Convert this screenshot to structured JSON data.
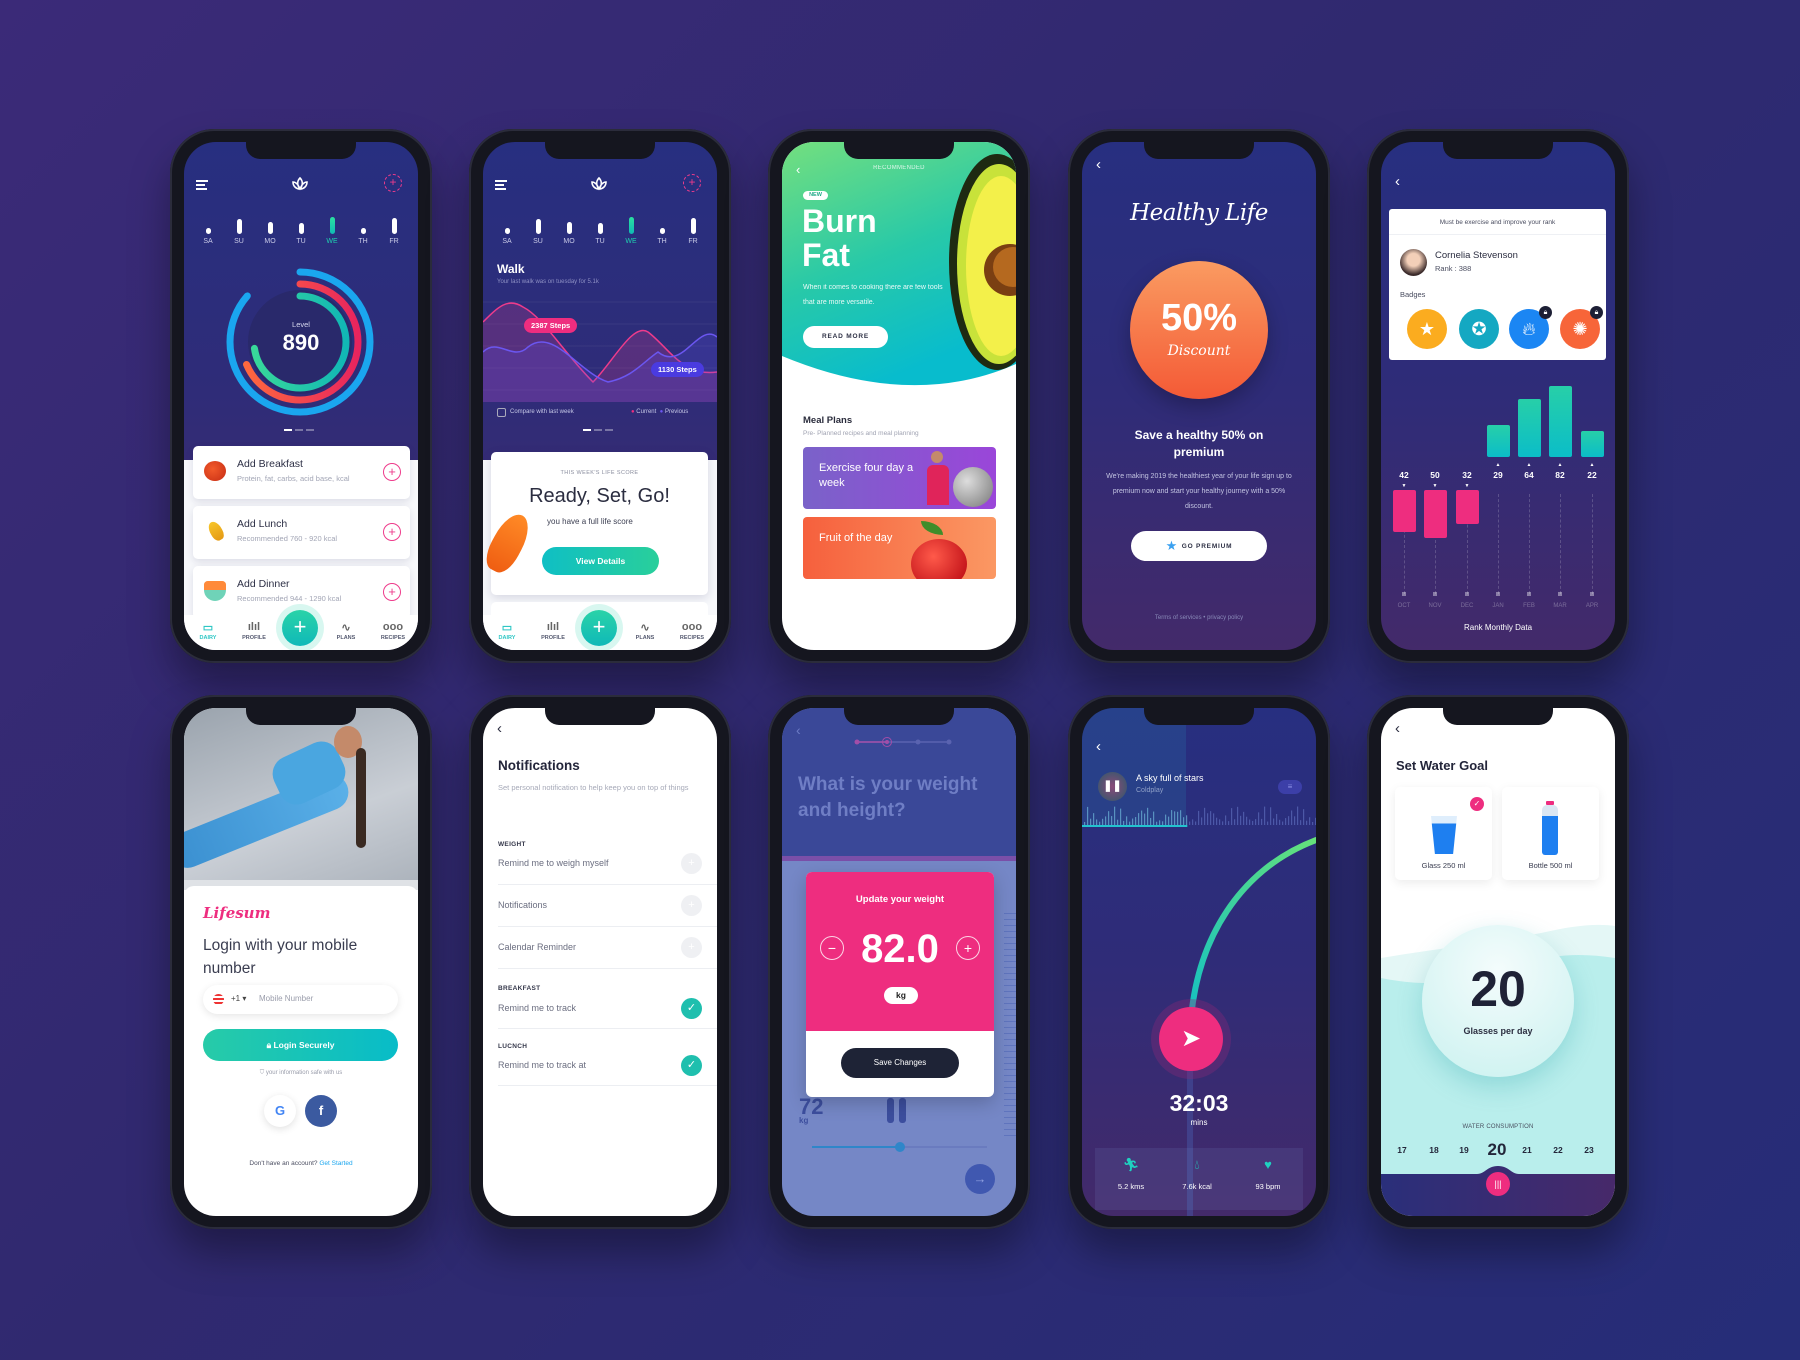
{
  "colors": {
    "accent_pink": "#ee2d7f",
    "accent_teal": "#14c3b4",
    "accent_green": "#2bd98f",
    "background": "#30296f",
    "phone_frame": "#15161f"
  },
  "screens": {
    "diary": {
      "days": [
        {
          "label": "SA",
          "level": 0.1
        },
        {
          "label": "SU",
          "level": 0.8
        },
        {
          "label": "MO",
          "level": 0.6
        },
        {
          "label": "TU",
          "level": 0.5
        },
        {
          "label": "WE",
          "level": 1.0,
          "active": true
        },
        {
          "label": "TH",
          "level": 0.1
        },
        {
          "label": "FR",
          "level": 0.9
        }
      ],
      "level_label": "Level",
      "level_value": "890",
      "meals": [
        {
          "title": "Add Breakfast",
          "subtitle": "Protein, fat, carbs, acid base, kcal",
          "icon": "fruit-icon"
        },
        {
          "title": "Add Lunch",
          "subtitle": "Recommended 760 - 920 kcal",
          "icon": "corn-icon"
        },
        {
          "title": "Add Dinner",
          "subtitle": "Recommended 944 - 1290 kcal",
          "icon": "salad-bowl-icon"
        }
      ],
      "nav": [
        {
          "label": "DAIRY",
          "icon": "calendar-icon",
          "active": true
        },
        {
          "label": "PROFILE",
          "icon": "bar-chart-icon"
        },
        {
          "label": "PLANS",
          "icon": "pulse-icon"
        },
        {
          "label": "RECIPES",
          "icon": "dots-icon"
        }
      ]
    },
    "walk": {
      "title": "Walk",
      "subtitle": "Your last walk was on tuesday for 5.1k",
      "current_badge": "2387 Steps",
      "previous_badge": "1130 Steps",
      "compare_label": "Compare with last week",
      "legend_current": "Current",
      "legend_previous": "Previous",
      "card_kicker": "THIS WEEK'S LIFE SCORE",
      "card_title": "Ready, Set, Go!",
      "card_text": "you have a full life score",
      "button": "View Details"
    },
    "recommended": {
      "header": "RECOMMENDED",
      "badge": "NEW",
      "title_line1": "Burn",
      "title_line2": "Fat",
      "description": "When it comes to cooking there are few tools that are more versatile.",
      "button": "READ MORE",
      "section_title": "Meal Plans",
      "section_subtitle": "Pre- Planned recipes and meal planning",
      "plan1": "Exercise four day a week",
      "plan2": "Fruit of the day"
    },
    "premium": {
      "logo_text": "Healthy Life",
      "discount_value": "50%",
      "discount_label": "Discount",
      "headline": "Save a healthy 50% on premium",
      "description": "We're making 2019 the healthiest year of your life sign up to premium now and start your healthy journey with a 50% discount.",
      "button": "GO PREMIUM",
      "footer_terms": "Terms of services",
      "footer_sep": "•",
      "footer_privacy": "privacy policy"
    },
    "rank": {
      "notice": "Must be exercise and improve your rank",
      "name": "Cornelia Stevenson",
      "rank": "Rank : 388",
      "badges_label": "Badges",
      "badges": [
        {
          "icon": "star-icon",
          "color": "#fbac1f",
          "locked": false
        },
        {
          "icon": "award-icon",
          "color": "#14a8c2",
          "locked": false
        },
        {
          "icon": "flame-icon",
          "color": "#1b86f3",
          "locked": true
        },
        {
          "icon": "gear-icon",
          "color": "#f76539",
          "locked": true
        }
      ],
      "chart_title": "Rank Monthly Data",
      "chart": {
        "type": "bar",
        "categories": [
          "OCT",
          "NOV",
          "DEC",
          "JAN",
          "FEB",
          "MAR",
          "APR"
        ],
        "values": [
          42,
          50,
          32,
          29,
          64,
          82,
          22
        ],
        "direction": [
          "down",
          "down",
          "down",
          "up",
          "up",
          "up",
          "up"
        ],
        "colors": {
          "up": "#17c8b8",
          "down": "#ee2d7f"
        }
      }
    },
    "login": {
      "brand": "Lifesum",
      "title": "Login with your mobile number",
      "country_code": "+1",
      "phone_placeholder": "Mobile Number",
      "button": "Login Securely",
      "safe_note": "your information safe with us",
      "signup_prompt": "Don't have an account?",
      "signup_link": "Get Started"
    },
    "notifications": {
      "title": "Notifications",
      "subtitle": "Set personal notification to help keep you on top of things",
      "weight_label": "WEIGHT",
      "row1": "Remind me to weigh myself",
      "row2": "Notifications",
      "row3": "Calendar Reminder",
      "breakfast_label": "BREAKFAST",
      "row4": "Remind me to track",
      "lunch_label": "LUCNCH",
      "row5": "Remind me to track at",
      "toggles": [
        false,
        false,
        false,
        true,
        true
      ]
    },
    "weight": {
      "question": "What is your weight and height?",
      "card_title": "Update your weight",
      "value": "82.0",
      "unit": "kg",
      "button": "Save Changes",
      "bg_value": "72",
      "bg_unit": "kg",
      "slider_fraction": 0.5,
      "step": 2,
      "steps_total": 4
    },
    "run": {
      "song": "A sky full of stars",
      "artist": "Coldplay",
      "track_progress": 0.45,
      "time": "32:03",
      "time_unit": "mins",
      "stats": [
        {
          "icon": "running-icon",
          "value": "5.2 kms"
        },
        {
          "icon": "drop-icon",
          "value": "7.6k kcal"
        },
        {
          "icon": "heart-rate-icon",
          "value": "93 bpm"
        }
      ]
    },
    "water": {
      "title": "Set Water Goal",
      "option1": "Glass 250 ml",
      "option2": "Bottle 500 ml",
      "selected_option": "Glass 250 ml",
      "goal": "20",
      "goal_unit": "Glasses per day",
      "consumption_label": "WATER CONSUMPTION",
      "scale": [
        "17",
        "18",
        "19",
        "20",
        "21",
        "22",
        "23"
      ],
      "selected": "20"
    }
  }
}
